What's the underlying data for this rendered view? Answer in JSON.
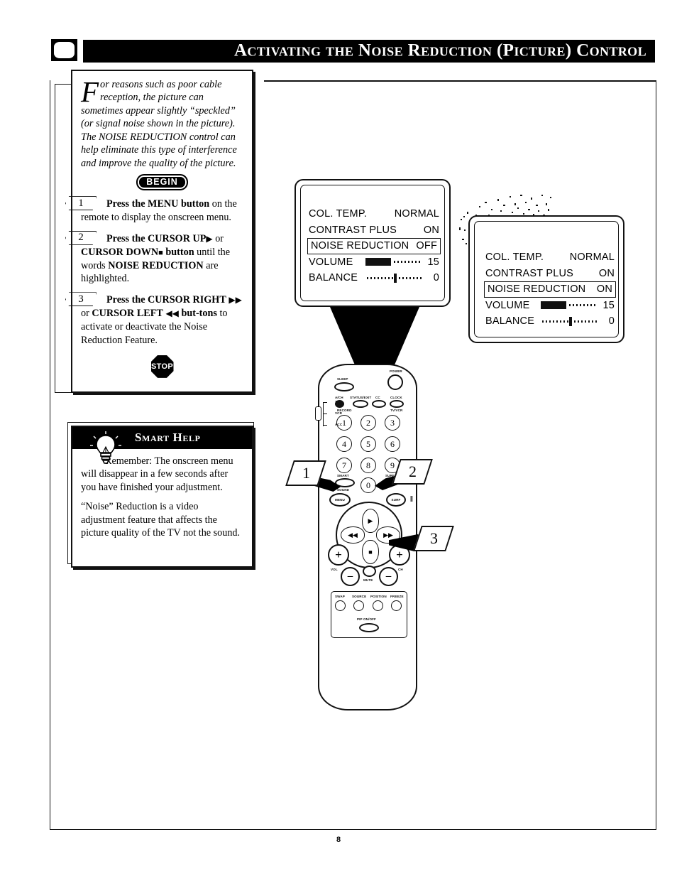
{
  "header": {
    "title": "Activating the Noise Reduction (Picture) Control",
    "tv_icon": "tv-screen-icon"
  },
  "intro": {
    "dropcap": "F",
    "text": "or reasons such as poor cable reception, the picture can sometimes appear slightly “speckled” (or signal noise shown in the picture). The NOISE REDUCTION control can help eliminate this type of interference and improve the quality of the picture.",
    "begin_badge": "BEGIN",
    "stop_badge": "STOP"
  },
  "steps": [
    {
      "number": "1",
      "line1_bold": "Press the MENU button",
      "line1_rest": " on the remote to display the onscreen menu."
    },
    {
      "number": "2",
      "line1_bold": "Press the CURSOR UP",
      "glyph_up": "▶",
      "line1_mid": " or ",
      "line2_bold": "CURSOR DOWN",
      "glyph_down": "■",
      "line2_bold2": " button",
      "line2_rest": " until the words ",
      "line3_bold": "NOISE REDUCTION",
      "line3_rest": " are highlighted."
    },
    {
      "number": "3",
      "line1_bold": "Press the CURSOR RIGHT",
      "glyph_right": "▶▶",
      "line1_mid": " or ",
      "line2_bold": "CURSOR LEFT",
      "glyph_left": "◀◀",
      "line2_bold2": " but-tons",
      "line2_rest": " to activate or deactivate the Noise Reduction Feature."
    }
  ],
  "smart_help": {
    "title": "Smart Help",
    "icon": "lightbulb-icon",
    "paragraphs": [
      "Remember: The onscreen menu will disappear in a few seconds after you have finished your adjustment.",
      "“Noise” Reduction is a video adjustment feature that affects the picture quality of the TV not the sound."
    ]
  },
  "tv_menus": [
    {
      "id": "tv-menu-before",
      "rows": [
        {
          "label": "COL. TEMP.",
          "value": "NORMAL",
          "type": "text",
          "highlighted": false
        },
        {
          "label": "CONTRAST PLUS",
          "value": "ON",
          "type": "text",
          "highlighted": false
        },
        {
          "label": "NOISE REDUCTION",
          "value": "OFF",
          "type": "text",
          "highlighted": true
        },
        {
          "label": "VOLUME",
          "value": "15",
          "type": "bar",
          "highlighted": false
        },
        {
          "label": "BALANCE",
          "value": "0",
          "type": "balance",
          "highlighted": false
        }
      ]
    },
    {
      "id": "tv-menu-after",
      "rows": [
        {
          "label": "COL. TEMP.",
          "value": "NORMAL",
          "type": "text",
          "highlighted": false
        },
        {
          "label": "CONTRAST PLUS",
          "value": "ON",
          "type": "text",
          "highlighted": false
        },
        {
          "label": "NOISE REDUCTION",
          "value": "ON",
          "type": "text",
          "highlighted": true
        },
        {
          "label": "VOLUME",
          "value": "15",
          "type": "bar",
          "highlighted": false
        },
        {
          "label": "BALANCE",
          "value": "0",
          "type": "balance",
          "highlighted": false
        }
      ]
    }
  ],
  "remote": {
    "top_labels": {
      "sleep": "SLEEP",
      "power": "POWER",
      "ach": "A/CH",
      "status_exit": "STATUS/EXIT",
      "cc": "CC",
      "clock": "CLOCK",
      "record": "RECORD",
      "tv_vcr": "TV/VCR"
    },
    "switch": {
      "tv": "TV",
      "vcr": "VCR",
      "acc": "ACC"
    },
    "keypad": [
      "1",
      "2",
      "3",
      "4",
      "5",
      "6",
      "7",
      "8",
      "9",
      "0"
    ],
    "keypad_sub": {
      "smart": "SMART",
      "sound": "SOUND",
      "surf": "SURF"
    },
    "mid_labels": {
      "menu": "MENU",
      "surf": "SURF",
      "pause": "‖"
    },
    "cursor": {
      "up": "▶",
      "down": "■",
      "left": "◀◀",
      "right": "▶▶"
    },
    "vol_ch": {
      "vol": "VOL",
      "ch": "CH",
      "mute": "MUTE",
      "plus": "+",
      "minus": "–"
    },
    "pip": {
      "swap": "SWAP",
      "source": "SOURCE",
      "position": "POSITION",
      "freeze": "FREEZE",
      "onoff": "PIP ON/OFF"
    }
  },
  "callouts": [
    {
      "number": "1",
      "points_to": "menu-button"
    },
    {
      "number": "2",
      "points_to": "cursor-up-button"
    },
    {
      "number": "3",
      "points_to": "cursor-right-button"
    }
  ],
  "page_number": "8"
}
